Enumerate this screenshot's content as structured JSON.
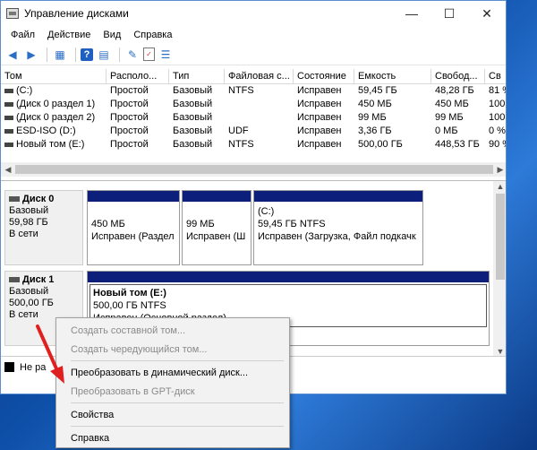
{
  "window": {
    "title": "Управление дисками"
  },
  "menu": [
    "Файл",
    "Действие",
    "Вид",
    "Справка"
  ],
  "table": {
    "columns": [
      "Том",
      "Располо...",
      "Тип",
      "Файловая с...",
      "Состояние",
      "Емкость",
      "Свобод...",
      "Св"
    ],
    "rows": [
      [
        "(C:)",
        "Простой",
        "Базовый",
        "NTFS",
        "Исправен",
        "59,45 ГБ",
        "48,28 ГБ",
        "81 %"
      ],
      [
        "(Диск 0 раздел 1)",
        "Простой",
        "Базовый",
        "",
        "Исправен",
        "450 МБ",
        "450 МБ",
        "100"
      ],
      [
        "(Диск 0 раздел 2)",
        "Простой",
        "Базовый",
        "",
        "Исправен",
        "99 МБ",
        "99 МБ",
        "100"
      ],
      [
        "ESD-ISO (D:)",
        "Простой",
        "Базовый",
        "UDF",
        "Исправен",
        "3,36 ГБ",
        "0 МБ",
        "0 %"
      ],
      [
        "Новый том (E:)",
        "Простой",
        "Базовый",
        "NTFS",
        "Исправен",
        "500,00 ГБ",
        "448,53 ГБ",
        "90 %"
      ]
    ]
  },
  "disks": {
    "disk0": {
      "name": "Диск 0",
      "type": "Базовый",
      "size": "59,98 ГБ",
      "status": "В сети",
      "parts": [
        {
          "title": "",
          "line1": "450 МБ",
          "line2": "Исправен (Раздел"
        },
        {
          "title": "",
          "line1": "99 МБ",
          "line2": "Исправен (Ш"
        },
        {
          "title": "(C:)",
          "line1": "59,45 ГБ NTFS",
          "line2": "Исправен (Загрузка, Файл подкачк"
        }
      ]
    },
    "disk1": {
      "name": "Диск 1",
      "type": "Базовый",
      "size": "500,00 ГБ",
      "status": "В сети",
      "part": {
        "title": "Новый том  (E:)",
        "line1": "500,00 ГБ NTFS",
        "line2": "Исправен (Основной раздел)"
      }
    }
  },
  "legend": {
    "label": "Не ра"
  },
  "context_menu": [
    "Создать составной том...",
    "Создать чередующийся том...",
    "Преобразовать в динамический диск...",
    "Преобразовать в GPT-диск",
    "Свойства",
    "Справка"
  ],
  "colors": {
    "partition_bar": "#0c1f7a",
    "arrow": "#e02020"
  }
}
